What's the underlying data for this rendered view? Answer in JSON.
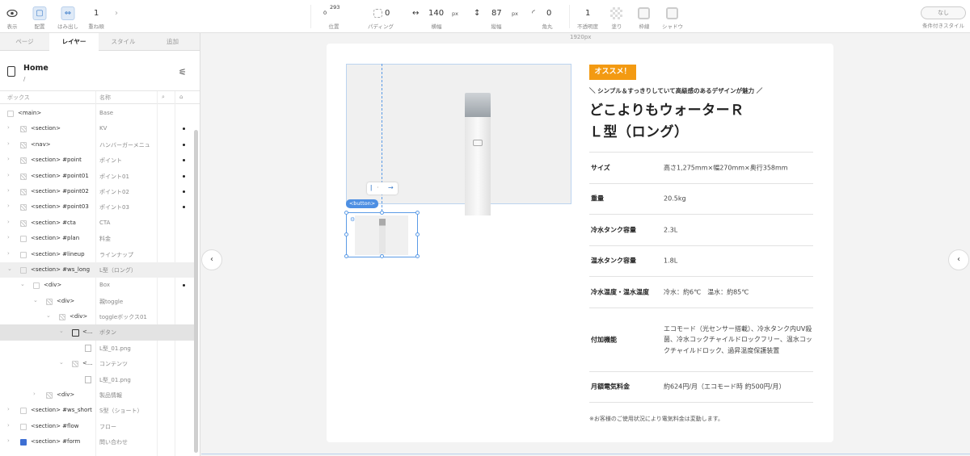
{
  "toolbar": {
    "view_label": "表示",
    "layout_label": "配置",
    "overflow_label": "はみ出し",
    "stack_value": "1",
    "stack_label": "重ね順",
    "pos_x": "0",
    "pos_y": "293",
    "pos_label": "位置",
    "padding_value": "0",
    "padding_label": "パディング",
    "width_value": "140",
    "width_unit": "px",
    "width_label": "横幅",
    "height_value": "87",
    "height_unit": "px",
    "height_label": "縦幅",
    "radius_value": "0",
    "radius_label": "角丸",
    "opacity_value": "1",
    "opacity_label": "不透明度",
    "fill_label": "塗り",
    "border_label": "枠線",
    "shadow_label": "シャドウ",
    "cond_style_value": "なし",
    "cond_style_label": "条件付きスタイル"
  },
  "panel": {
    "tabs": [
      "ページ",
      "レイヤー",
      "スタイル",
      "追加"
    ],
    "active_tab": "レイヤー",
    "page_name": "Home",
    "page_path": "/",
    "col_box": "ボックス",
    "col_name": "名称"
  },
  "layers": [
    {
      "name": "<main>",
      "label": "Base",
      "dot": false
    },
    {
      "name": "<section>",
      "label": "KV",
      "dot": true
    },
    {
      "name": "<nav>",
      "label": "ハンバーガーメニュ",
      "dot": true
    },
    {
      "name": "<section> #point",
      "label": "ポイント",
      "dot": true
    },
    {
      "name": "<section> #point01",
      "label": "ポイント01",
      "dot": true
    },
    {
      "name": "<section> #point02",
      "label": "ポイント02",
      "dot": true
    },
    {
      "name": "<section> #point03",
      "label": "ポイント03",
      "dot": true
    },
    {
      "name": "<section> #cta",
      "label": "CTA",
      "dot": false
    },
    {
      "name": "<section> #plan",
      "label": "料金",
      "dot": false
    },
    {
      "name": "<section> #lineup",
      "label": "ラインナップ",
      "dot": false
    },
    {
      "name": "<section> #ws_long",
      "label": "L型（ロング）",
      "dot": false
    },
    {
      "name": "<div>",
      "label": "Box",
      "dot": true
    },
    {
      "name": "<div>",
      "label": "親toggle",
      "dot": false
    },
    {
      "name": "<div>",
      "label": "toggleボックス01",
      "dot": false
    },
    {
      "name": "<...",
      "label": "ボタン",
      "dot": false
    },
    {
      "name": "",
      "label": "L型_01.png",
      "dot": false
    },
    {
      "name": "<...",
      "label": "コンテンツ",
      "dot": false
    },
    {
      "name": "",
      "label": "L型_01.png",
      "dot": false
    },
    {
      "name": "<div>",
      "label": "製品情報",
      "dot": false
    },
    {
      "name": "<section> #ws_short",
      "label": "S型（ショート）",
      "dot": false
    },
    {
      "name": "<section> #flow",
      "label": "フロー",
      "dot": false
    },
    {
      "name": "<section> #form",
      "label": "問い合わせ",
      "dot": false
    }
  ],
  "canvas": {
    "ruler_label": "1920px",
    "button_tag": "<button>",
    "badge": "オススメ！",
    "tagline": "＼ シンプル＆すっきりしていて高級感のあるデザインが魅力 ／",
    "title_line1": "どこよりもウォーターＲ",
    "title_line2": "Ｌ型（ロング）",
    "specs": [
      {
        "key": "サイズ",
        "value": "高さ1,275mm×幅270mm×奥行358mm"
      },
      {
        "key": "重量",
        "value": "20.5kg"
      },
      {
        "key": "冷水タンク容量",
        "value": "2.3L"
      },
      {
        "key": "温水タンク容量",
        "value": "1.8L"
      },
      {
        "key": "冷水温度・温水温度",
        "value": "冷水：約6℃　温水：約85℃"
      },
      {
        "key": "付加機能",
        "value": "エコモード（光センサー搭載）、冷水タンク内UV殺菌、冷水コックチャイルドロックフリー、温水コックチャイルドロック、過昇温度保護装置"
      },
      {
        "key": "月額電気料金",
        "value": "約624円/月（エコモード時 約500円/月）"
      }
    ],
    "note": "※お客様のご使用状況により電気料金は変動します。"
  },
  "colors": {
    "accent": "#4d8fe3",
    "badge": "#f39a12",
    "form_square": "#3d6fd3"
  }
}
